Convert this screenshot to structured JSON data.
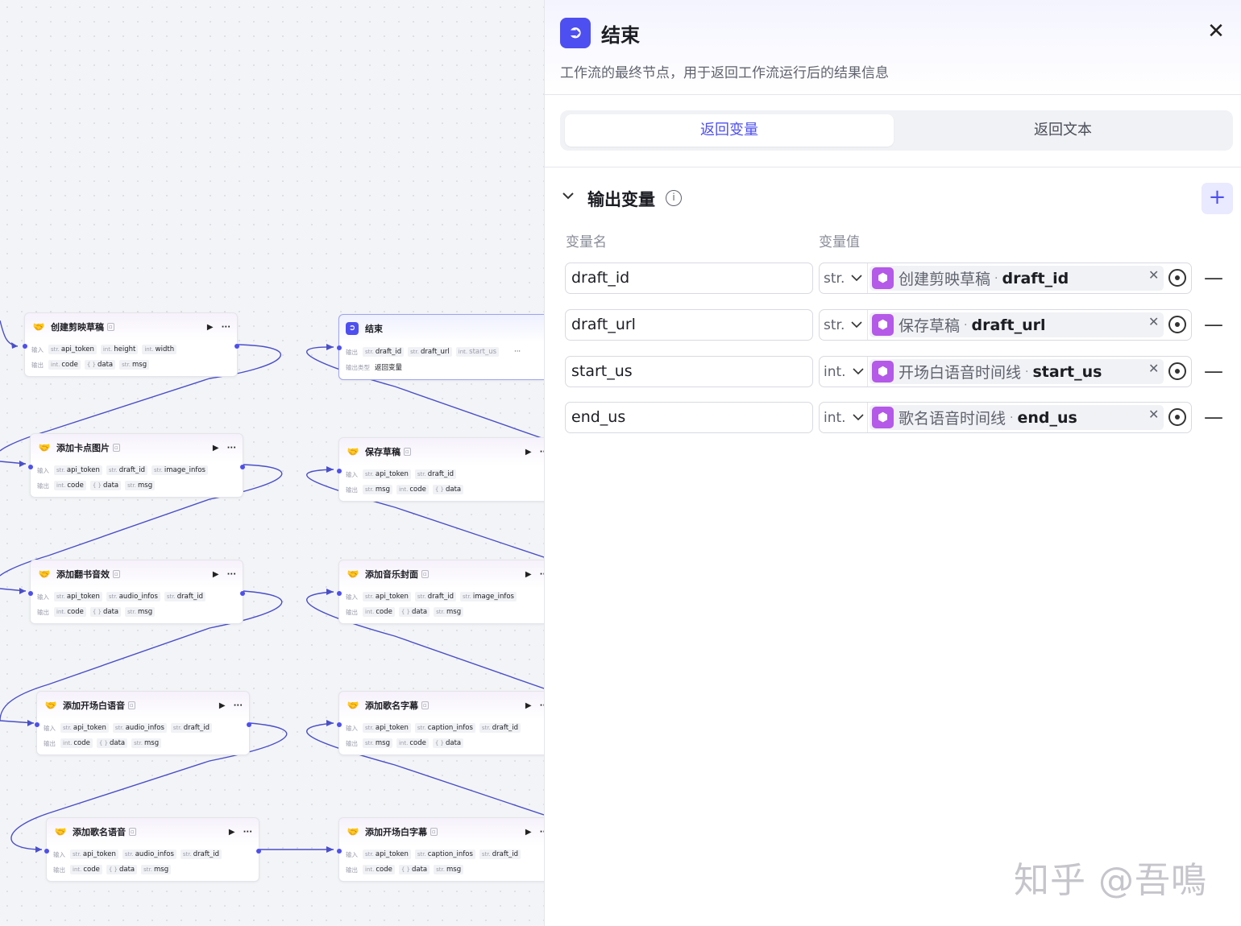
{
  "canvas": {
    "nodes": [
      {
        "title": "创建剪映草稿",
        "in_label": "输入",
        "inputs": [
          {
            "t": "str.",
            "n": "api_token"
          },
          {
            "t": "int.",
            "n": "height"
          },
          {
            "t": "int.",
            "n": "width"
          }
        ],
        "out_label": "输出",
        "outputs": [
          {
            "t": "int.",
            "n": "code"
          },
          {
            "t": "{ }",
            "n": "data"
          },
          {
            "t": "str.",
            "n": "msg"
          }
        ]
      },
      {
        "title": "添加卡点图片",
        "in_label": "输入",
        "inputs": [
          {
            "t": "str.",
            "n": "api_token"
          },
          {
            "t": "str.",
            "n": "draft_id"
          },
          {
            "t": "str.",
            "n": "image_infos"
          }
        ],
        "out_label": "输出",
        "outputs": [
          {
            "t": "int.",
            "n": "code"
          },
          {
            "t": "{ }",
            "n": "data"
          },
          {
            "t": "str.",
            "n": "msg"
          }
        ]
      },
      {
        "title": "添加翻书音效",
        "in_label": "输入",
        "inputs": [
          {
            "t": "str.",
            "n": "api_token"
          },
          {
            "t": "str.",
            "n": "audio_infos"
          },
          {
            "t": "str.",
            "n": "draft_id"
          }
        ],
        "out_label": "输出",
        "outputs": [
          {
            "t": "int.",
            "n": "code"
          },
          {
            "t": "{ }",
            "n": "data"
          },
          {
            "t": "str.",
            "n": "msg"
          }
        ]
      },
      {
        "title": "添加开场白语音",
        "in_label": "输入",
        "inputs": [
          {
            "t": "str.",
            "n": "api_token"
          },
          {
            "t": "str.",
            "n": "audio_infos"
          },
          {
            "t": "str.",
            "n": "draft_id"
          }
        ],
        "out_label": "输出",
        "outputs": [
          {
            "t": "int.",
            "n": "code"
          },
          {
            "t": "{ }",
            "n": "data"
          },
          {
            "t": "str.",
            "n": "msg"
          }
        ]
      },
      {
        "title": "添加歌名语音",
        "in_label": "输入",
        "inputs": [
          {
            "t": "str.",
            "n": "api_token"
          },
          {
            "t": "str.",
            "n": "audio_infos"
          },
          {
            "t": "str.",
            "n": "draft_id"
          }
        ],
        "out_label": "输出",
        "outputs": [
          {
            "t": "int.",
            "n": "code"
          },
          {
            "t": "{ }",
            "n": "data"
          },
          {
            "t": "str.",
            "n": "msg"
          }
        ]
      },
      {
        "title": "保存草稿",
        "in_label": "输入",
        "inputs": [
          {
            "t": "str.",
            "n": "api_token"
          },
          {
            "t": "str.",
            "n": "draft_id"
          }
        ],
        "out_label": "输出",
        "outputs": [
          {
            "t": "str.",
            "n": "msg"
          },
          {
            "t": "int.",
            "n": "code"
          },
          {
            "t": "{ }",
            "n": "data"
          }
        ]
      },
      {
        "title": "添加音乐封面",
        "in_label": "输入",
        "inputs": [
          {
            "t": "str.",
            "n": "api_token"
          },
          {
            "t": "str.",
            "n": "draft_id"
          },
          {
            "t": "str.",
            "n": "image_infos"
          }
        ],
        "out_label": "输出",
        "outputs": [
          {
            "t": "int.",
            "n": "code"
          },
          {
            "t": "{ }",
            "n": "data"
          },
          {
            "t": "str.",
            "n": "msg"
          }
        ]
      },
      {
        "title": "添加歌名字幕",
        "in_label": "输入",
        "inputs": [
          {
            "t": "str.",
            "n": "api_token"
          },
          {
            "t": "str.",
            "n": "caption_infos"
          },
          {
            "t": "str.",
            "n": "draft_id"
          }
        ],
        "out_label": "输出",
        "outputs": [
          {
            "t": "str.",
            "n": "msg"
          },
          {
            "t": "int.",
            "n": "code"
          },
          {
            "t": "{ }",
            "n": "data"
          }
        ]
      },
      {
        "title": "添加开场白字幕",
        "in_label": "输入",
        "inputs": [
          {
            "t": "str.",
            "n": "api_token"
          },
          {
            "t": "str.",
            "n": "caption_infos"
          },
          {
            "t": "str.",
            "n": "draft_id"
          }
        ],
        "out_label": "输出",
        "outputs": [
          {
            "t": "int.",
            "n": "code"
          },
          {
            "t": "{ }",
            "n": "data"
          },
          {
            "t": "str.",
            "n": "msg"
          }
        ]
      }
    ],
    "end_node": {
      "title": "结束",
      "out_label": "输出",
      "outputs": [
        {
          "t": "str.",
          "n": "draft_id"
        },
        {
          "t": "str.",
          "n": "draft_url"
        },
        {
          "t": "int.",
          "n": "start_us"
        }
      ],
      "type_label": "输出类型",
      "type_value": "返回变量",
      "more": "···"
    },
    "run_icon": "▶",
    "more_icon": "···"
  },
  "panel": {
    "title": "结束",
    "description": "工作流的最终节点，用于返回工作流运行后的结果信息",
    "tabs": [
      "返回变量",
      "返回文本"
    ],
    "section_title": "输出变量",
    "col_name": "变量名",
    "col_value": "变量值",
    "variables": [
      {
        "name": "draft_id",
        "type": "str.",
        "ref_node": "创建剪映草稿",
        "ref_var": "draft_id"
      },
      {
        "name": "draft_url",
        "type": "str.",
        "ref_node": "保存草稿",
        "ref_var": "draft_url"
      },
      {
        "name": "start_us",
        "type": "int.",
        "ref_node": "开场白语音时间线",
        "ref_var": "start_us"
      },
      {
        "name": "end_us",
        "type": "int.",
        "ref_node": "歌名语音时间线",
        "ref_var": "end_us"
      }
    ]
  },
  "watermark": "知乎 @吾鳴",
  "colors": {
    "accent": "#4e4ff0",
    "ref_icon": "#b459e8",
    "wire": "#4a4fc8"
  }
}
